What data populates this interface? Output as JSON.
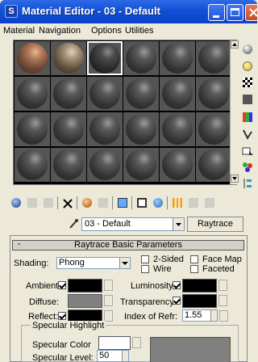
{
  "window": {
    "title": "Material Editor - 03 - Default",
    "app_icon": "3ds-max-icon",
    "app_icon_letter": "S"
  },
  "menu": {
    "items": [
      "Material",
      "Navigation",
      "Options",
      "Utilities"
    ]
  },
  "toolbar": {
    "material_name": "03 - Default",
    "material_type": "Raytrace"
  },
  "rollout": {
    "title": "Raytrace Basic Parameters",
    "collapse_symbol": "-",
    "shading_label": "Shading:",
    "shading_value": "Phong",
    "two_sided_label": "2-Sided",
    "wire_label": "Wire",
    "face_map_label": "Face Map",
    "faceted_label": "Faceted",
    "ambient_label": "Ambient:",
    "diffuse_label": "Diffuse:",
    "reflect_label": "Reflect:",
    "luminosity_label": "Luminosity:",
    "transparency_label": "Transparency:",
    "index_of_refr_label": "Index of Refr:",
    "index_of_refr_value": "1.55",
    "specular_group_title": "Specular Highlight",
    "specular_color_label": "Specular Color",
    "specular_level_label": "Specular Level:",
    "specular_level_value": "50",
    "colors": {
      "ambient": "#000000",
      "diffuse": "#808080",
      "reflect": "#000000",
      "luminosity": "#000000",
      "transparency": "#000000",
      "specular": "#ffffff"
    },
    "checks": {
      "two_sided": false,
      "wire": false,
      "face_map": false,
      "faceted": false,
      "ambient_lock": true,
      "reflect_lock": true,
      "luminosity_lock": true,
      "transparency_lock": true
    }
  }
}
